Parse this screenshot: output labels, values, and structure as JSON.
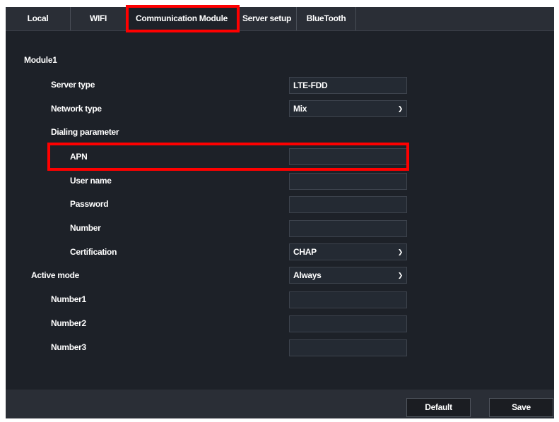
{
  "tabs": [
    {
      "label": "Local"
    },
    {
      "label": "WIFI"
    },
    {
      "label": "Communication Module"
    },
    {
      "label": "Server setup"
    },
    {
      "label": "BlueTooth"
    }
  ],
  "active_tab": "Communication Module",
  "module1": {
    "heading": "Module1",
    "server_type_label": "Server type",
    "server_type_value": "LTE-FDD",
    "network_type_label": "Network type",
    "network_type_value": "Mix",
    "dialing_label": "Dialing parameter",
    "apn_label": "APN",
    "apn_value": "",
    "username_label": "User name",
    "username_value": "",
    "password_label": "Password",
    "password_value": "",
    "number_label": "Number",
    "number_value": "",
    "certification_label": "Certification",
    "certification_value": "CHAP"
  },
  "active_mode": {
    "label": "Active mode",
    "value": "Always",
    "number1_label": "Number1",
    "number1_value": "",
    "number2_label": "Number2",
    "number2_value": "",
    "number3_label": "Number3",
    "number3_value": ""
  },
  "footer": {
    "default_label": "Default",
    "save_label": "Save"
  },
  "icons": {
    "dropdown": "chevron-down-icon"
  },
  "colors": {
    "highlight": "#ff0000",
    "background": "#1d2128",
    "bar": "#2a2e36"
  }
}
